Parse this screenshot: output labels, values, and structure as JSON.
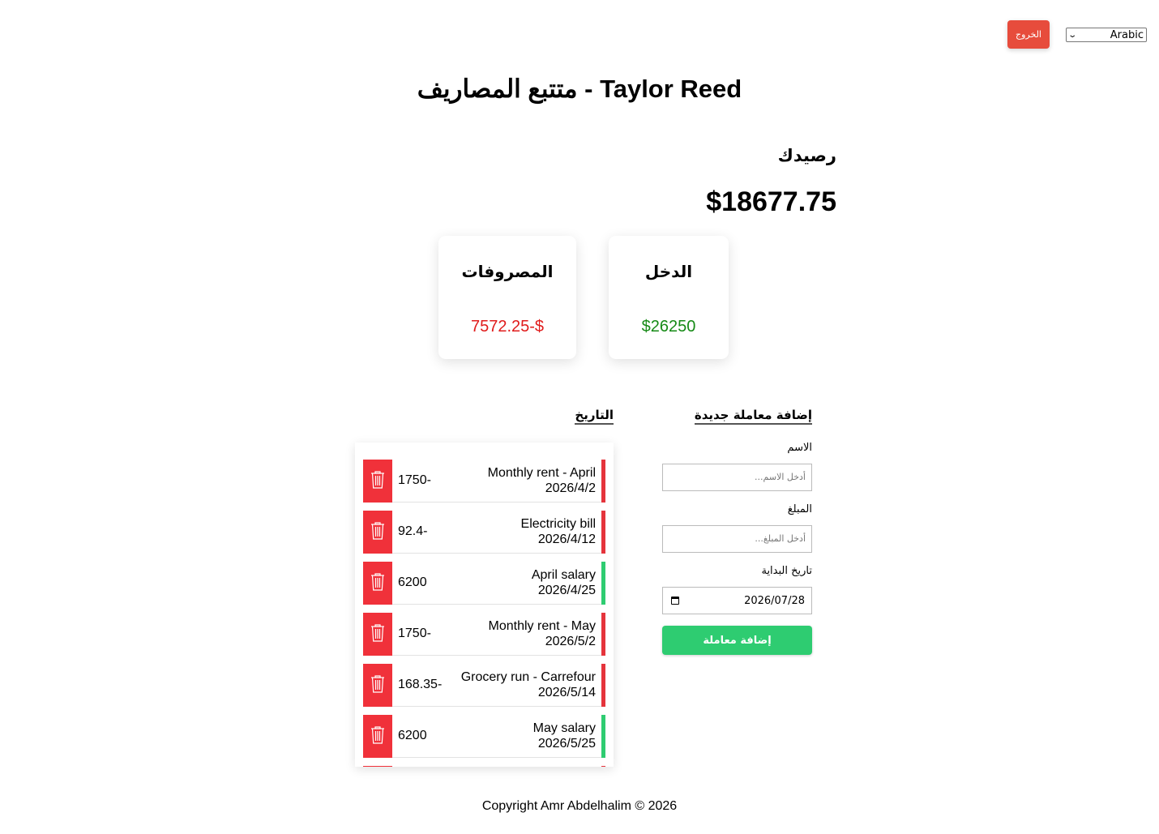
{
  "header": {
    "logout_label": "الخروج",
    "language": "Arabic"
  },
  "title": "Taylor Reed - متتبع المصاريف",
  "balance": {
    "label": "رصيدك",
    "value": "$18677.75"
  },
  "summary": {
    "expenses_label": "المصروفات",
    "expenses_value": "7572.25-$",
    "income_label": "الدخل",
    "income_value": "$26250"
  },
  "history": {
    "heading": "التاريخ",
    "transactions": [
      {
        "name": "Monthly rent - April",
        "date": "2026/4/2",
        "amount": "1750-",
        "type": "expense"
      },
      {
        "name": "Electricity bill",
        "date": "2026/4/12",
        "amount": "92.4-",
        "type": "expense"
      },
      {
        "name": "April salary",
        "date": "2026/4/25",
        "amount": "6200",
        "type": "income"
      },
      {
        "name": "Monthly rent - May",
        "date": "2026/5/2",
        "amount": "1750-",
        "type": "expense"
      },
      {
        "name": "Grocery run - Carrefour",
        "date": "2026/5/14",
        "amount": "168.35-",
        "type": "expense"
      },
      {
        "name": "May salary",
        "date": "2026/5/25",
        "amount": "6200",
        "type": "income"
      }
    ]
  },
  "form": {
    "heading": "إضافة معاملة جديدة",
    "name_label": "الاسم",
    "name_placeholder": "أدخل الاسم...",
    "amount_label": "المبلغ",
    "amount_placeholder": "أدخل المبلغ...",
    "date_label": "تاريخ البداية",
    "date_value": "2026/07/28",
    "submit_label": "إضافة معاملة"
  },
  "footer": "Copyright Amr Abdelhalim © 2026",
  "colors": {
    "expense": "#e5343c",
    "income": "#2ecc71",
    "delete_button": "#f0313a",
    "logout_button": "#e74c3c"
  }
}
